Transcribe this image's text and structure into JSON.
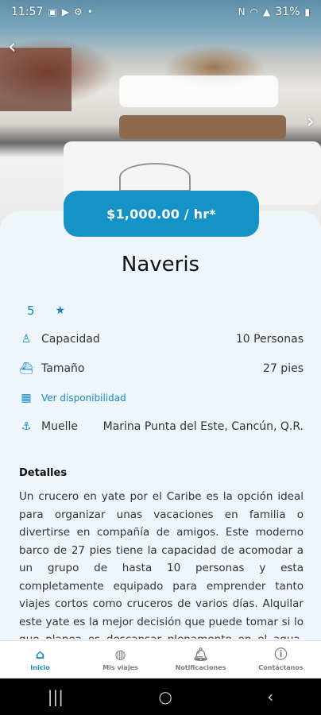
{
  "status_bar": {
    "time": "11:57",
    "battery": "31%"
  },
  "listing": {
    "price": "$1,000.00 / hr*",
    "name": "Naveris",
    "rating": "5",
    "capacity_label": "Capacidad",
    "capacity_value": "10 Personas",
    "size_label": "Tamaño",
    "size_value": "27 pies",
    "availability_link": "Ver disponibilidad",
    "dock_label": "Muelle",
    "dock_value": "Marina Punta del Este, Cancún, Q.R."
  },
  "details": {
    "title": "Detalles",
    "body": "Un crucero en yate por el Caribe es la opción ideal para organizar unas vacaciones en familia o divertirse en compañía de amigos. Este moderno barco de 27 pies tiene la capacidad de acomodar a un grupo de hasta 10 personas y esta completamente equipado para emprender tanto viajes cortos como cruceros de varios días. Alquilar este yate es la mejor decisión que puede tomar si lo que planea es descansar plenamente en el agua. Este yate"
  },
  "tabs": [
    {
      "label": "Inicio",
      "icon": "home-icon",
      "active": true
    },
    {
      "label": "Mis viajes",
      "icon": "ship-icon",
      "active": false
    },
    {
      "label": "Notificaciones",
      "icon": "bell-icon",
      "active": false
    },
    {
      "label": "Contáctanos",
      "icon": "help-icon",
      "active": false
    }
  ],
  "colors": {
    "accent": "#1593c6",
    "card_bg": "#eef5fb"
  }
}
